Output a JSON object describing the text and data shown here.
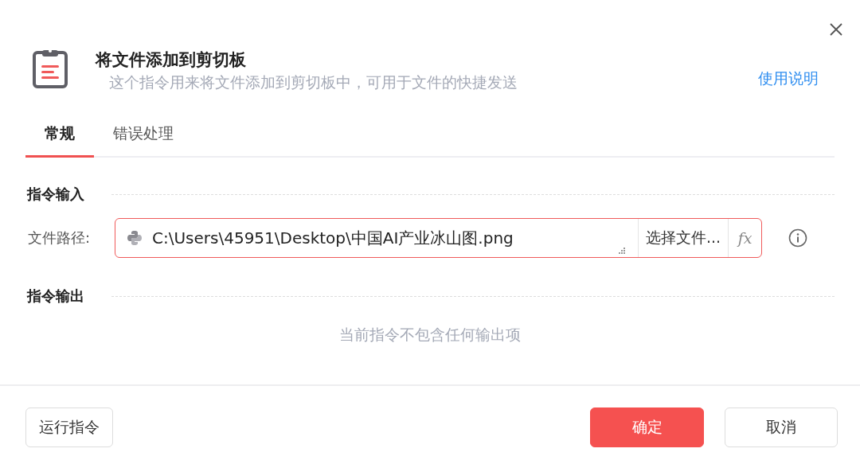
{
  "dialog": {
    "title": "将文件添加到剪切板",
    "description": "这个指令用来将文件添加到剪切板中，可用于文件的快捷发送",
    "help_link": "使用说明"
  },
  "tabs": [
    {
      "label": "常规",
      "selected": true
    },
    {
      "label": "错误处理",
      "selected": false
    }
  ],
  "input_section": {
    "heading": "指令输入",
    "fields": [
      {
        "label": "文件路径:",
        "value": "C:\\Users\\45951\\Desktop\\中国AI产业冰山图.png",
        "error": true,
        "browse_button": "选择文件...",
        "expression_button": "fx"
      }
    ]
  },
  "output_section": {
    "heading": "指令输出",
    "empty_text": "当前指令不包含任何输出项"
  },
  "footer": {
    "run_button": "运行指令",
    "ok_button": "确定",
    "cancel_button": "取消"
  }
}
